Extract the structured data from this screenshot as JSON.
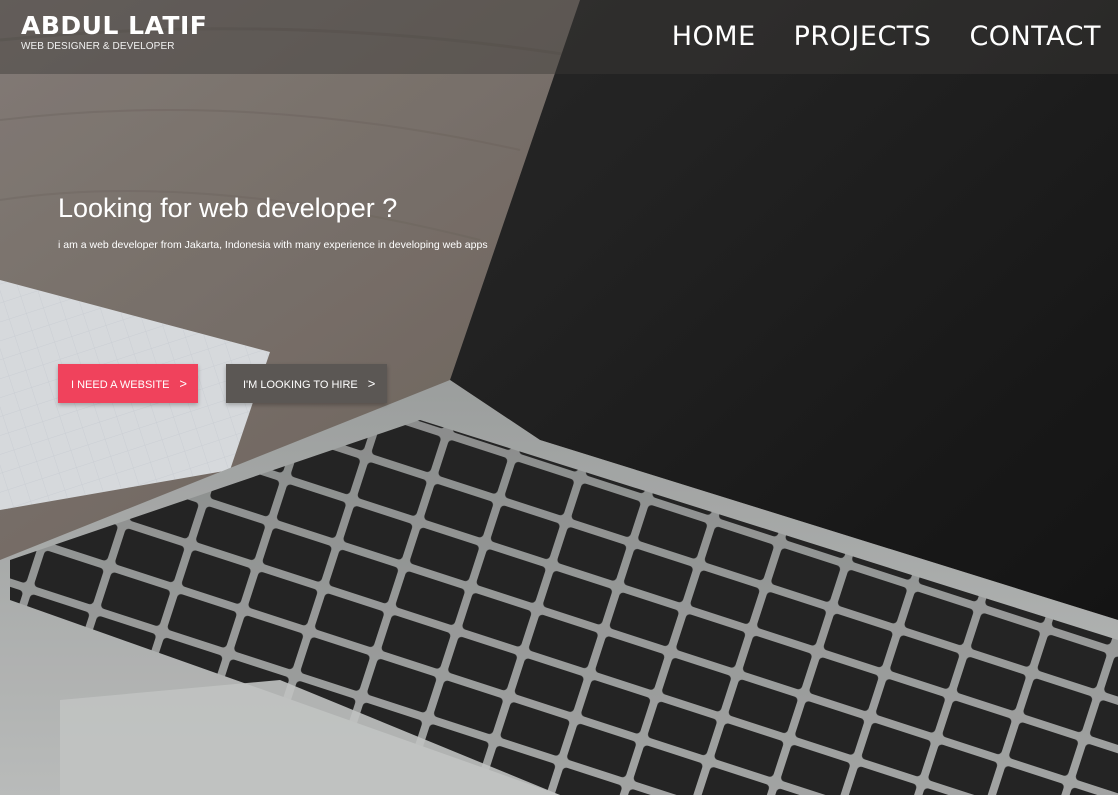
{
  "header": {
    "brand_name": "ABDUL LATIF",
    "brand_tagline": "WEB DESIGNER & DEVELOPER",
    "nav": [
      {
        "label": "HOME"
      },
      {
        "label": "PROJECTS"
      },
      {
        "label": "CONTACT"
      }
    ]
  },
  "hero": {
    "title": "Looking for web developer ?",
    "subtitle": "i am a web developer from Jakarta, Indonesia with many experience in developing web apps",
    "primary_button": {
      "label": "I NEED A WEBSITE",
      "icon": "chevron-right-icon"
    },
    "secondary_button": {
      "label": "I'M LOOKING TO HIRE",
      "icon": "chevron-right-icon"
    }
  },
  "colors": {
    "accent": "#f0425c",
    "secondary_button": "#5b5754",
    "header_bg": "rgba(60,58,56,0.45)"
  }
}
